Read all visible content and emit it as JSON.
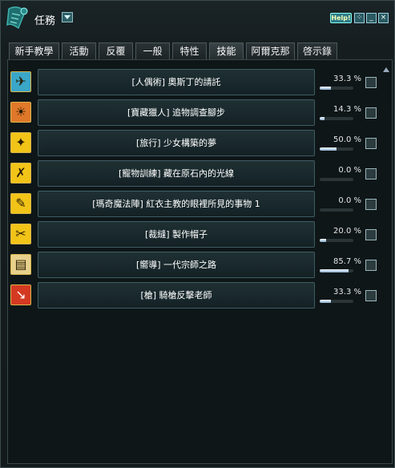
{
  "window": {
    "title": "任務",
    "help_label": "Help!",
    "buttons": [
      "⁘",
      "_",
      "×"
    ]
  },
  "tabs": [
    {
      "label": "新手教學",
      "active": false
    },
    {
      "label": "活動",
      "active": false
    },
    {
      "label": "反覆",
      "active": false
    },
    {
      "label": "一般",
      "active": false
    },
    {
      "label": "特性",
      "active": false
    },
    {
      "label": "技能",
      "active": true
    },
    {
      "label": "阿爾克那",
      "active": false
    },
    {
      "label": "啓示錄",
      "active": false
    }
  ],
  "quests": [
    {
      "name": "[人偶術] 奧斯丁的請託",
      "percent": "33.3 %",
      "progress": 0.333,
      "icon": "marionette-icon",
      "icon_bg": "#3aa6c8",
      "checked": false
    },
    {
      "name": "[寶藏獵人] 追物調查腳步",
      "percent": "14.3 %",
      "progress": 0.143,
      "icon": "treasure-sun-icon",
      "icon_bg": "#e0782a",
      "checked": false
    },
    {
      "name": "[旅行] 少女構築的夢",
      "percent": "50.0 %",
      "progress": 0.5,
      "icon": "compass-star-icon",
      "icon_bg": "#f2c418",
      "checked": false
    },
    {
      "name": "[寵物訓練] 藏在原石內的光線",
      "percent": "0.0 %",
      "progress": 0.0,
      "icon": "pet-training-icon",
      "icon_bg": "#f2c418",
      "checked": false
    },
    {
      "name": "[瑪奇魔法陣] 紅衣主教的眼裡所見的事物 1",
      "percent": "0.0 %",
      "progress": 0.0,
      "icon": "magic-circle-icon",
      "icon_bg": "#f2c418",
      "checked": false
    },
    {
      "name": "[裁縫] 製作帽子",
      "percent": "20.0 %",
      "progress": 0.2,
      "icon": "tailoring-icon",
      "icon_bg": "#f2c418",
      "checked": false
    },
    {
      "name": "[嚮導] 一代宗師之路",
      "percent": "85.7 %",
      "progress": 0.857,
      "icon": "guide-scroll-icon",
      "icon_bg": "#e7d18c",
      "checked": false
    },
    {
      "name": "[槍] 騎槍反擊老師",
      "percent": "33.3 %",
      "progress": 0.333,
      "icon": "lance-icon",
      "icon_bg": "#d43a22",
      "checked": false
    }
  ]
}
